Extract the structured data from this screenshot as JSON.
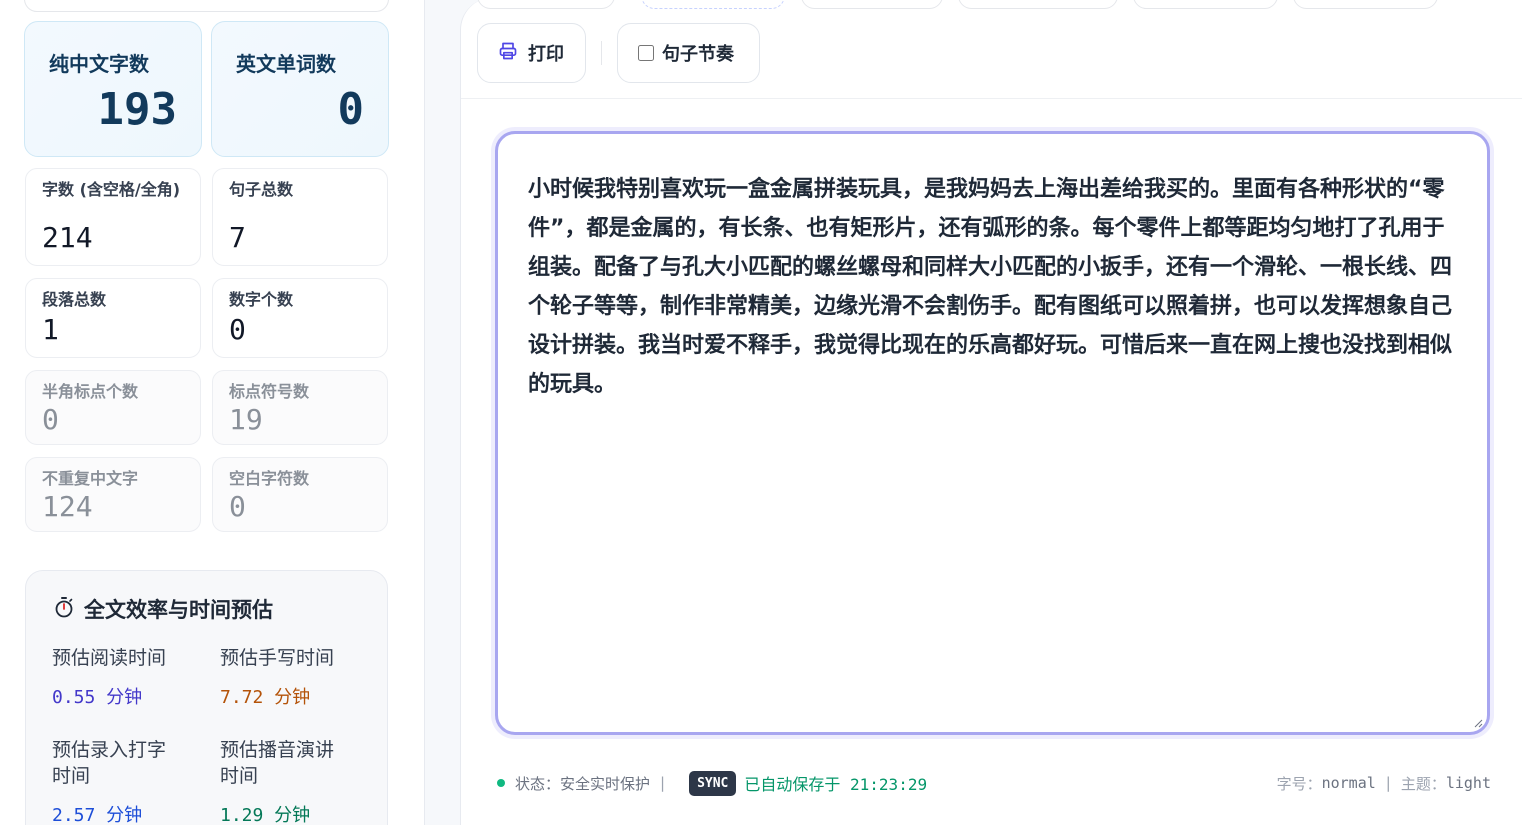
{
  "stats": {
    "chinese_chars": {
      "label": "纯中文字数",
      "value": "193"
    },
    "english_words": {
      "label": "英文单词数",
      "value": "0"
    },
    "char_count": {
      "label": "字数 (含空格/全角)",
      "value": "214"
    },
    "sentences": {
      "label": "句子总数",
      "value": "7"
    },
    "paragraphs": {
      "label": "段落总数",
      "value": "1"
    },
    "digits": {
      "label": "数字个数",
      "value": "0"
    },
    "half_punct": {
      "label": "半角标点个数",
      "value": "0"
    },
    "punctuation": {
      "label": "标点符号数",
      "value": "19"
    },
    "unique_chinese": {
      "label": "不重复中文字",
      "value": "124"
    },
    "whitespace": {
      "label": "空白字符数",
      "value": "0"
    }
  },
  "efficiency": {
    "title": "全文效率与时间预估",
    "icon": "stopwatch-icon",
    "items": [
      {
        "label": "预估阅读时间",
        "value": "0.55  分钟",
        "color": "#4338ca"
      },
      {
        "label": "预估手写时间",
        "value": "7.72  分钟",
        "color": "#b45309"
      },
      {
        "label": "预估录入打字时间",
        "value": "2.57  分钟",
        "color": "#1d4ed8"
      },
      {
        "label": "预估播音演讲时间",
        "value": "1.29  分钟",
        "color": "#047857"
      }
    ]
  },
  "toolbar": {
    "print_label": "打印",
    "rhythm_label": "句子节奏",
    "rhythm_checked": false
  },
  "editor": {
    "text": "小时候我特别喜欢玩一盒金属拼装玩具，是我妈妈去上海出差给我买的。里面有各种形状的“零件”，都是金属的，有长条、也有矩形片，还有弧形的条。每个零件上都等距均匀地打了孔用于组装。配备了与孔大小匹配的螺丝螺母和同样大小匹配的小扳手，还有一个滑轮、一根长线、四个轮子等等，制作非常精美，边缘光滑不会割伤手。配有图纸可以照着拼，也可以发挥想象自己设计拼装。我当时爱不释手，我觉得比现在的乐高都好玩。可惜后来一直在网上搜也没找到相似的玩具。"
  },
  "status": {
    "state": "状态：安全实时保护",
    "sep": "|",
    "sync_badge": "SYNC",
    "saved": "已自动保存于 21:23:29",
    "font_label": "字号：",
    "font_value": "normal",
    "theme_label": "主题：",
    "theme_value": "light"
  }
}
